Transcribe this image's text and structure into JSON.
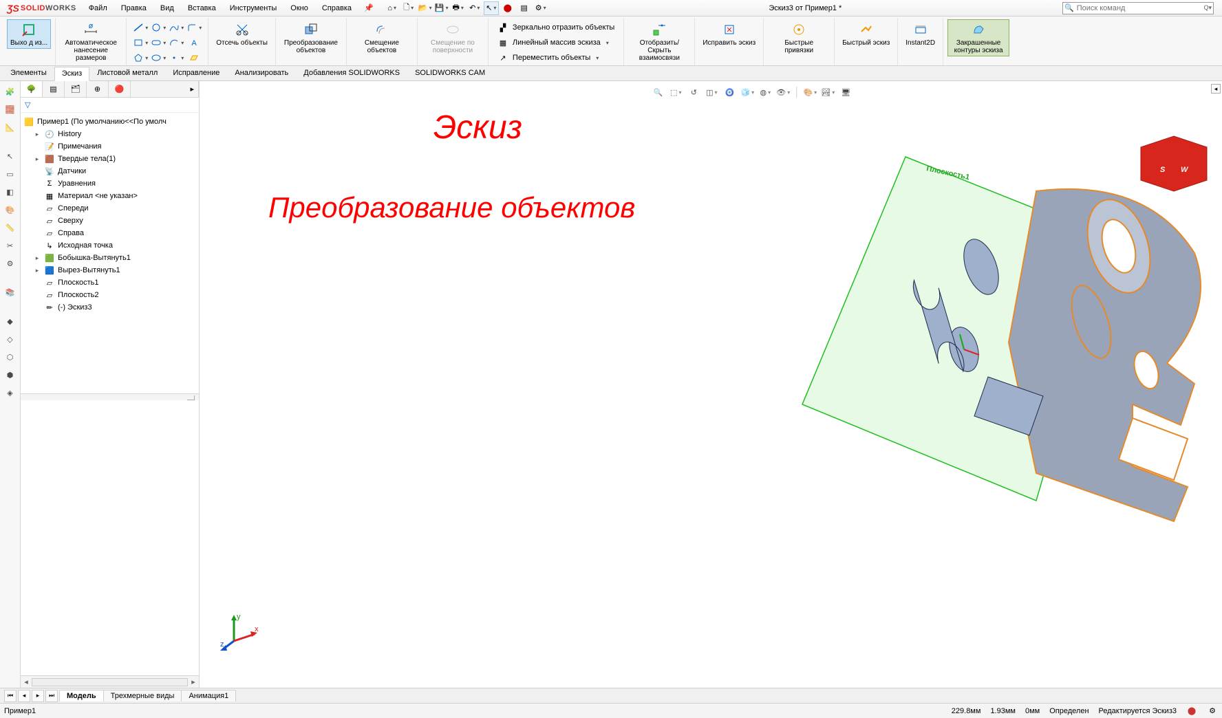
{
  "app": {
    "logo_text_solid": "SOLID",
    "logo_text_works": "WORKS",
    "document_title": "Эскиз3 от Пример1 *",
    "search_placeholder": "Поиск команд"
  },
  "menu": {
    "file": "Файл",
    "edit": "Правка",
    "view": "Вид",
    "insert": "Вставка",
    "tools": "Инструменты",
    "window": "Окно",
    "help": "Справка"
  },
  "ribbon": {
    "exit": "Выхо д из...",
    "smart_dim": "Автоматическое нанесение размеров",
    "trim": "Отсечь объекты",
    "convert": "Преобразование объектов",
    "offset": "Смещение объектов",
    "offset_surface": "Смещение по поверхности",
    "mirror": "Зеркально отразить объекты",
    "linear_pattern": "Линейный массив эскиза",
    "move": "Переместить объекты",
    "show_hide": "Отобразить/Скрыть взаимосвязи",
    "repair": "Исправить эскиз",
    "quick_snaps": "Быстрые привязки",
    "rapid_sketch": "Быстрый эскиз",
    "instant2d": "Instant2D",
    "shaded_contours": "Закрашенные контуры эскиза"
  },
  "tabs": {
    "features": "Элементы",
    "sketch": "Эскиз",
    "sheet_metal": "Листовой металл",
    "evaluate": "Исправление",
    "analyze": "Анализировать",
    "sw_addins": "Добавления SOLIDWORKS",
    "sw_cam": "SOLIDWORKS CAM"
  },
  "tree": {
    "root": "Пример1  (По умолчанию<<По умолч",
    "history": "History",
    "annotations": "Примечания",
    "solid_bodies": "Твердые тела(1)",
    "sensors": "Датчики",
    "equations": "Уравнения",
    "material": "Материал <не указан>",
    "front": "Спереди",
    "top": "Сверху",
    "right": "Справа",
    "origin": "Исходная точка",
    "boss": "Бобышка-Вытянуть1",
    "cut": "Вырез-Вытянуть1",
    "plane1": "Плоскость1",
    "plane2": "Плоскость2",
    "sketch3": "(-) Эскиз3"
  },
  "viewport": {
    "plane_label": "Плоскость1",
    "overlay_title": "Эскиз",
    "overlay_subtitle": "Преобразование объектов"
  },
  "bottom_tabs": {
    "model": "Модель",
    "views3d": "Трехмерные виды",
    "anim": "Анимация1"
  },
  "status": {
    "doc": "Пример1",
    "coord": "229.8мм",
    "val2": "1.93мм",
    "val3": "0мм",
    "defined": "Определен",
    "editing": "Редактируется Эскиз3"
  }
}
